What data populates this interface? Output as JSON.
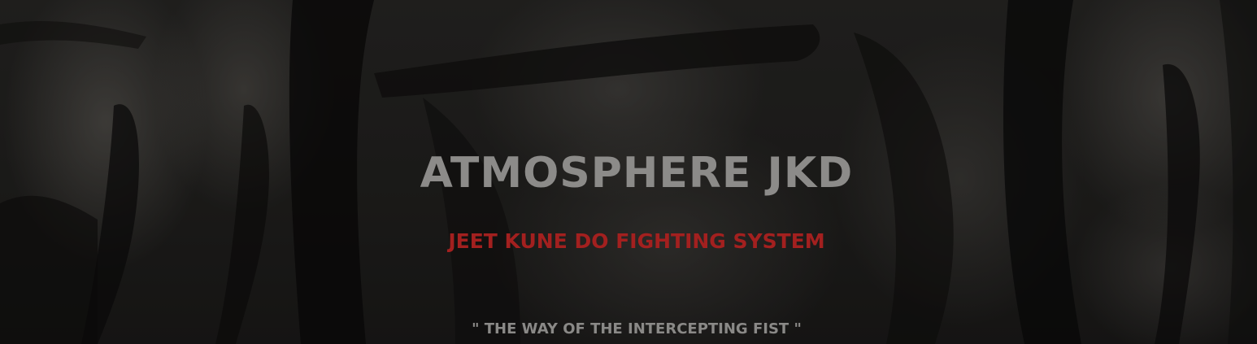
{
  "hero": {
    "title": "ATMOSPHERE JKD",
    "subtitle": "JEET KUNE DO FIGHTING SYSTEM",
    "tagline": "\" THE WAY OF THE INTERCEPTING FIST \"",
    "background_image": "boxing-gloves-photo"
  },
  "colors": {
    "title": "#8c8b89",
    "subtitle": "#a3201f",
    "tagline": "#8a8987",
    "background": "#242321"
  }
}
